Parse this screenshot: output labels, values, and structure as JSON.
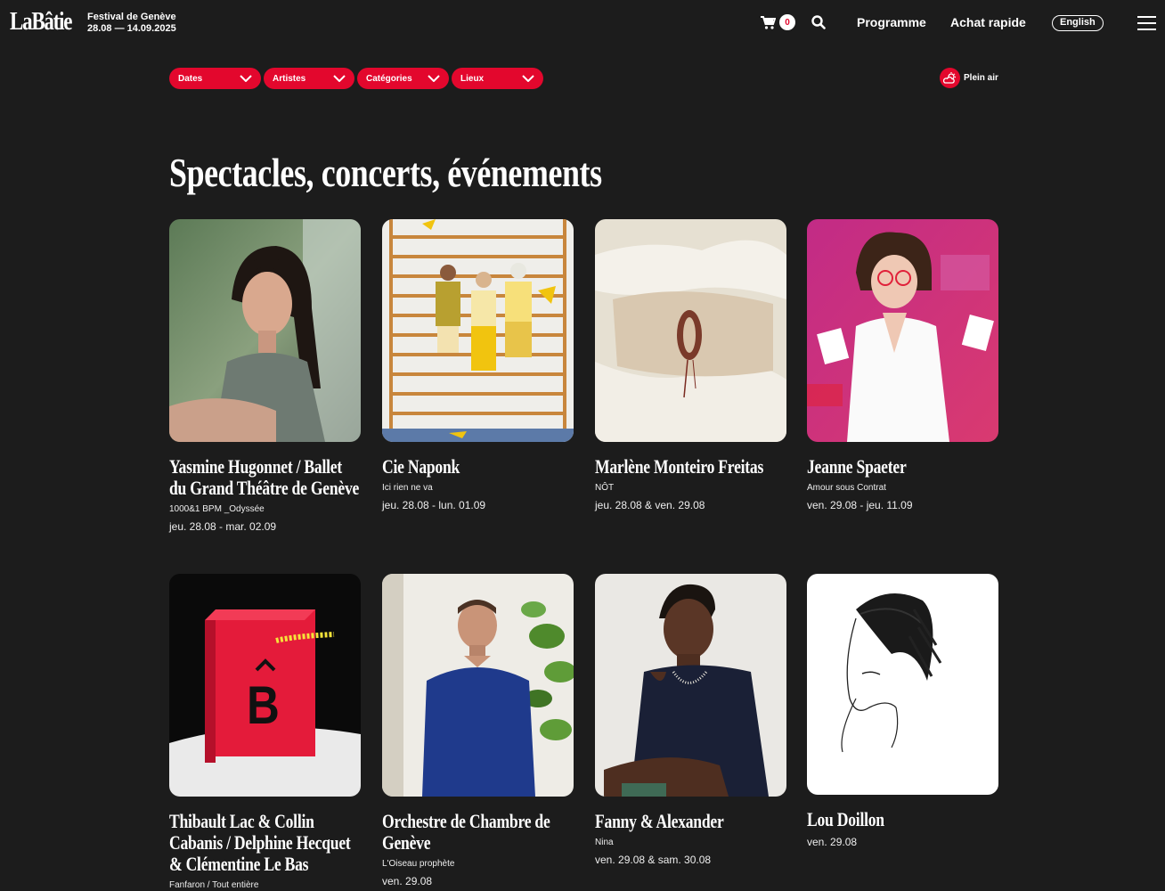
{
  "header": {
    "logo": "LaBâtie",
    "festival_name": "Festival de Genève",
    "festival_dates": "28.08 — 14.09.2025",
    "cart_count": "0",
    "nav_programme": "Programme",
    "nav_achat": "Achat rapide",
    "language": "English"
  },
  "filters": {
    "items": [
      {
        "label": "Dates"
      },
      {
        "label": "Artistes"
      },
      {
        "label": "Catégories"
      },
      {
        "label": "Lieux"
      }
    ],
    "plein_air": "Plein air"
  },
  "main": {
    "title": "Spectacles, concerts, événements",
    "cards": [
      {
        "name": "Yasmine Hugonnet / Ballet du Grand Théâtre de Genève",
        "subtitle": "1000&1 BPM _Odyssée",
        "dates": "jeu. 28.08 - mar. 02.09"
      },
      {
        "name": "Cie Naponk",
        "subtitle": "Ici rien ne va",
        "dates": "jeu. 28.08 - lun. 01.09"
      },
      {
        "name": "Marlène Monteiro Freitas",
        "subtitle": "NÔT",
        "dates": "jeu. 28.08 & ven. 29.08"
      },
      {
        "name": "Jeanne Spaeter",
        "subtitle": "Amour sous Contrat",
        "dates": "ven. 29.08 - jeu. 11.09"
      },
      {
        "name": "Thibault Lac & Collin Cabanis / Delphine Hecquet & Clémentine Le Bas",
        "subtitle": "Fanfaron / Tout entière",
        "dates": ""
      },
      {
        "name": "Orchestre de Chambre de Genève",
        "subtitle": "L'Oiseau prophète",
        "dates": "ven. 29.08"
      },
      {
        "name": "Fanny & Alexander",
        "subtitle": "Nina",
        "dates": "ven. 29.08 & sam. 30.08"
      },
      {
        "name": "Lou Doillon",
        "subtitle": "",
        "dates": "ven. 29.08"
      }
    ],
    "box_letter": "B"
  },
  "colors": {
    "accent": "#e3072d",
    "background": "#1c1c1c",
    "text": "#ffffff"
  }
}
